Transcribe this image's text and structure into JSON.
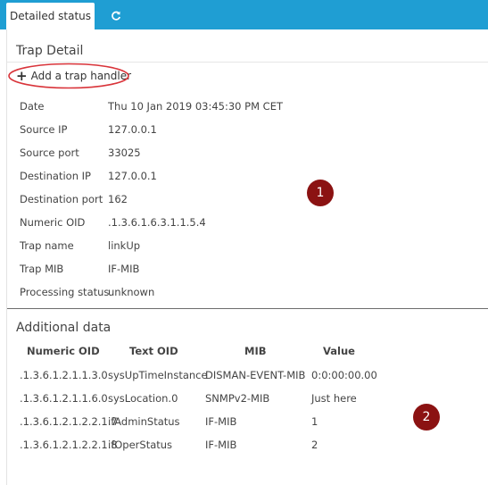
{
  "tabs": [
    {
      "label": "Detailed status",
      "active": true
    },
    {
      "icon": "refresh-icon"
    }
  ],
  "colors": {
    "tabbar": "#1f9ed3",
    "highlight": "#d9343a",
    "marker": "#8b1212"
  },
  "trap_detail": {
    "title": "Trap Detail",
    "add_handler_label": "Add a trap handler",
    "rows": [
      {
        "label": "Date",
        "value": "Thu 10 Jan 2019 03:45:30 PM CET"
      },
      {
        "label": "Source IP",
        "value": "127.0.0.1"
      },
      {
        "label": "Source port",
        "value": "33025"
      },
      {
        "label": "Destination IP",
        "value": "127.0.0.1"
      },
      {
        "label": "Destination port",
        "value": "162"
      },
      {
        "label": "Numeric OID",
        "value": ".1.3.6.1.6.3.1.1.5.4"
      },
      {
        "label": "Trap name",
        "value": "linkUp"
      },
      {
        "label": "Trap MIB",
        "value": "IF-MIB"
      },
      {
        "label": "Processing status",
        "value": "unknown"
      }
    ]
  },
  "additional_data": {
    "title": "Additional data",
    "columns": [
      "Numeric OID",
      "Text OID",
      "MIB",
      "Value"
    ],
    "rows": [
      [
        ".1.3.6.1.2.1.1.3.0",
        "sysUpTimeInstance",
        "DISMAN-EVENT-MIB",
        "0:0:00:00.00"
      ],
      [
        ".1.3.6.1.2.1.1.6.0",
        "sysLocation.0",
        "SNMPv2-MIB",
        "Just here"
      ],
      [
        ".1.3.6.1.2.1.2.2.1.7",
        "ifAdminStatus",
        "IF-MIB",
        "1"
      ],
      [
        ".1.3.6.1.2.1.2.2.1.8",
        "ifOperStatus",
        "IF-MIB",
        "2"
      ]
    ]
  },
  "markers": [
    "1",
    "2"
  ]
}
